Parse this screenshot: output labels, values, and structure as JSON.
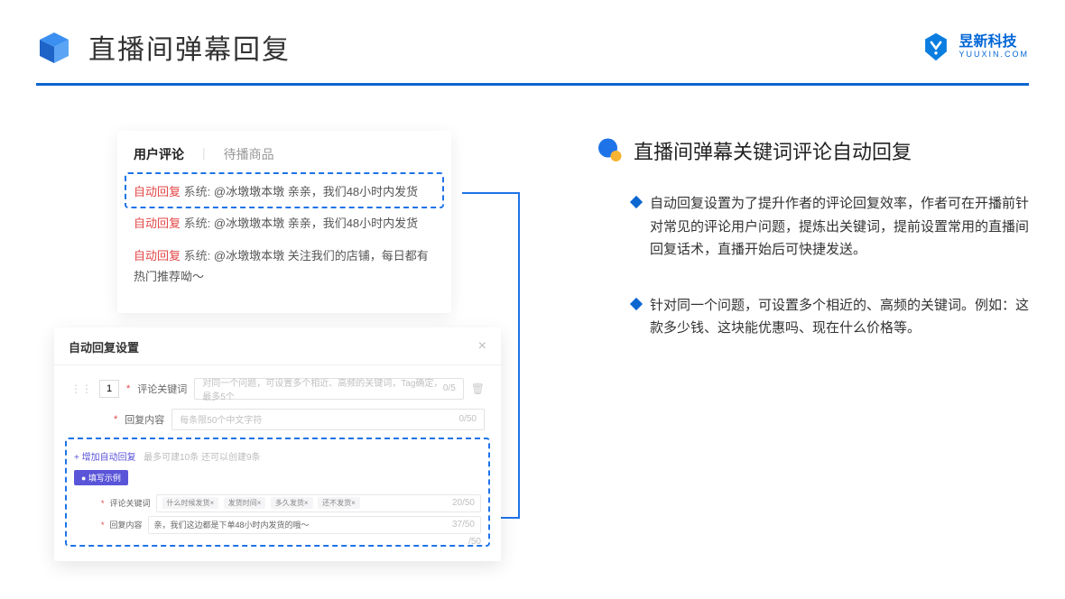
{
  "header": {
    "title": "直播间弹幕回复",
    "brand_name": "昱新科技",
    "brand_url": "YUUXIN.COM"
  },
  "comments_card": {
    "tab_active": "用户评论",
    "tab_inactive": "待播商品",
    "rows": [
      {
        "tag": "自动回复",
        "sys": "系统:",
        "text": "@冰墩墩本墩 亲亲，我们48小时内发货"
      },
      {
        "tag": "自动回复",
        "sys": "系统:",
        "text": "@冰墩墩本墩 亲亲，我们48小时内发货"
      },
      {
        "tag": "自动回复",
        "sys": "系统:",
        "text": "@冰墩墩本墩 关注我们的店铺，每日都有热门推荐呦～"
      }
    ]
  },
  "settings_card": {
    "title": "自动回复设置",
    "num": "1",
    "field1_label": "评论关键词",
    "field1_placeholder": "对同一个问题，可设置多个相近、高频的关键词，Tag确定，最多5个",
    "field1_counter": "0/5",
    "field2_label": "回复内容",
    "field2_placeholder": "每条限50个中文字符",
    "field2_counter": "0/50",
    "add_link": "+ 增加自动回复",
    "add_hint": "最多可建10条 还可以创建9条",
    "example_badge": "● 填写示例",
    "ex1_label": "评论关键词",
    "ex1_chips": [
      "什么时候发货×",
      "发货时间×",
      "多久发货×",
      "还不发货×"
    ],
    "ex1_counter": "20/50",
    "ex2_label": "回复内容",
    "ex2_text": "亲，我们这边都是下单48小时内发货的哦～",
    "ex2_counter": "37/50",
    "stray_counter": "/50"
  },
  "right": {
    "section_title": "直播间弹幕关键词评论自动回复",
    "bullets": [
      "自动回复设置为了提升作者的评论回复效率，作者可在开播前针对常见的评论用户问题，提炼出关键词，提前设置常用的直播间回复话术，直播开始后可快捷发送。",
      "针对同一个问题，可设置多个相近的、高频的关键词。例如：这款多少钱、这块能优惠吗、现在什么价格等。"
    ]
  }
}
